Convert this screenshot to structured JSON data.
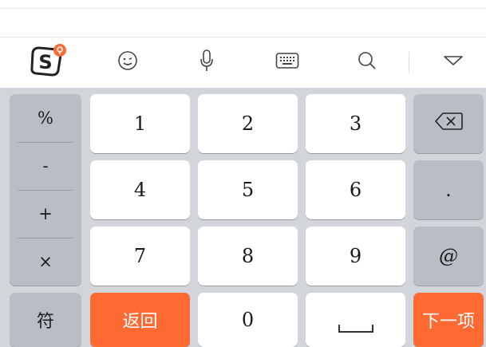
{
  "toolbar": {
    "logo_icon": "sogou-logo-icon",
    "icons": [
      "emoji-icon",
      "microphone-icon",
      "keyboard-icon",
      "search-icon",
      "collapse-icon"
    ],
    "accent": "#ff6a33"
  },
  "keyboard": {
    "symbols": [
      "%",
      "-",
      "+",
      "×"
    ],
    "fu_label": "符",
    "digits": [
      "1",
      "2",
      "3",
      "4",
      "5",
      "6",
      "7",
      "8",
      "9"
    ],
    "zero": "0",
    "back_label": "返回",
    "next_label": "下一项",
    "dot_label": ".",
    "at_label": "@",
    "backspace_icon": "backspace-icon",
    "space_icon": "space-icon"
  }
}
